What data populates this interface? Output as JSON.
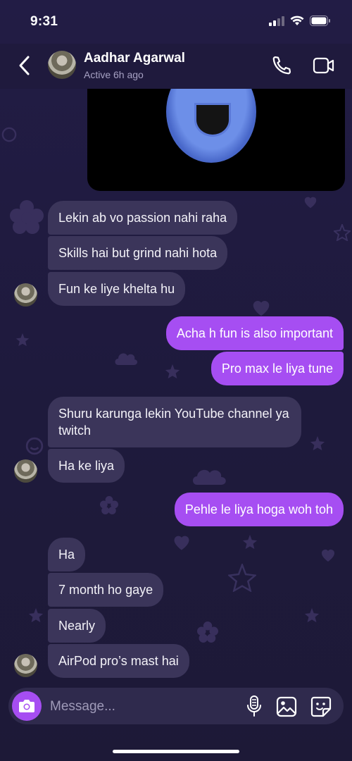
{
  "status": {
    "time": "9:31"
  },
  "header": {
    "name": "Aadhar Agarwal",
    "status": "Active 6h ago"
  },
  "messages": [
    {
      "dir": "in",
      "text": "Lekin ab vo passion nahi raha"
    },
    {
      "dir": "in",
      "text": "Skills hai but grind nahi hota"
    },
    {
      "dir": "in",
      "text": "Fun ke liye khelta hu"
    },
    {
      "dir": "out",
      "text": "Acha h fun is also important"
    },
    {
      "dir": "out",
      "text": "Pro max le liya tune"
    },
    {
      "dir": "in",
      "text": "Shuru karunga lekin YouTube channel ya twitch"
    },
    {
      "dir": "in",
      "text": "Ha ke liya"
    },
    {
      "dir": "out",
      "text": "Pehle le liya hoga woh toh"
    },
    {
      "dir": "in",
      "text": "Ha"
    },
    {
      "dir": "in",
      "text": "7 month ho gaye"
    },
    {
      "dir": "in",
      "text": "Nearly"
    },
    {
      "dir": "in",
      "text": "AirPod pro’s mast hai"
    }
  ],
  "composer": {
    "placeholder": "Message..."
  },
  "colors": {
    "accent": "#a64ef2",
    "incoming": "#3b355a",
    "background": "#1f1a3d"
  }
}
